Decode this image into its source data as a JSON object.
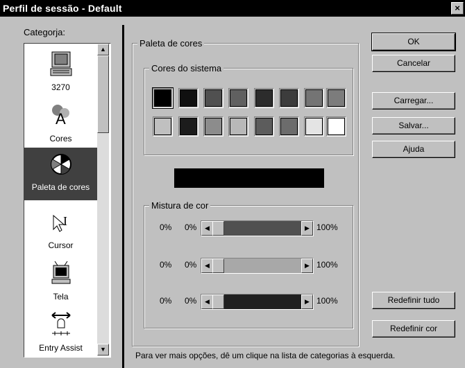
{
  "window": {
    "title": "Perfil de sessão - Default",
    "close_label": "×"
  },
  "sidebar": {
    "label": "Categorja:",
    "items": [
      {
        "label": "3270",
        "icon": "terminal-icon"
      },
      {
        "label": "Cores",
        "icon": "colors-icon"
      },
      {
        "label": "Paleta de cores",
        "icon": "palette-icon",
        "selected": true
      },
      {
        "label": "Cursor",
        "icon": "cursor-icon"
      },
      {
        "label": "Tela",
        "icon": "screen-icon"
      },
      {
        "label": "Entry Assist",
        "icon": "entry-assist-icon"
      }
    ],
    "scroll_up": "▲",
    "scroll_down": "▼"
  },
  "palette": {
    "group_label": "Paleta de cores",
    "system_colors_label": "Cores do sistema",
    "row1": [
      "#000000",
      "#101010",
      "#505050",
      "#606060",
      "#2c2c2c",
      "#3c3c3c",
      "#747474",
      "#7c7c7c"
    ],
    "row2": [
      "#c0c0c0",
      "#1c1c1c",
      "#8c8c8c",
      "#b8b8b8",
      "#5c5c5c",
      "#6c6c6c",
      "#e4e4e4",
      "#ffffff"
    ],
    "preview_color": "#000000",
    "mix_label": "Mistura de cor",
    "sliders": [
      {
        "left_pct": "0%",
        "value_pct": "0%",
        "max_pct": "100%",
        "track_color": "#505050"
      },
      {
        "left_pct": "0%",
        "value_pct": "0%",
        "max_pct": "100%",
        "track_color": "#a8a8a8"
      },
      {
        "left_pct": "0%",
        "value_pct": "0%",
        "max_pct": "100%",
        "track_color": "#202020"
      }
    ],
    "arrow_left": "◀",
    "arrow_right": "▶"
  },
  "buttons": {
    "ok": "OK",
    "cancel": "Cancelar",
    "load": "Carregar...",
    "save": "Salvar...",
    "help": "Ajuda",
    "reset_all": "Redefinir tudo",
    "reset_color": "Redefinir cor"
  },
  "hint": "Para ver mais opções, dê um clique na lista de categorias à esquerda."
}
